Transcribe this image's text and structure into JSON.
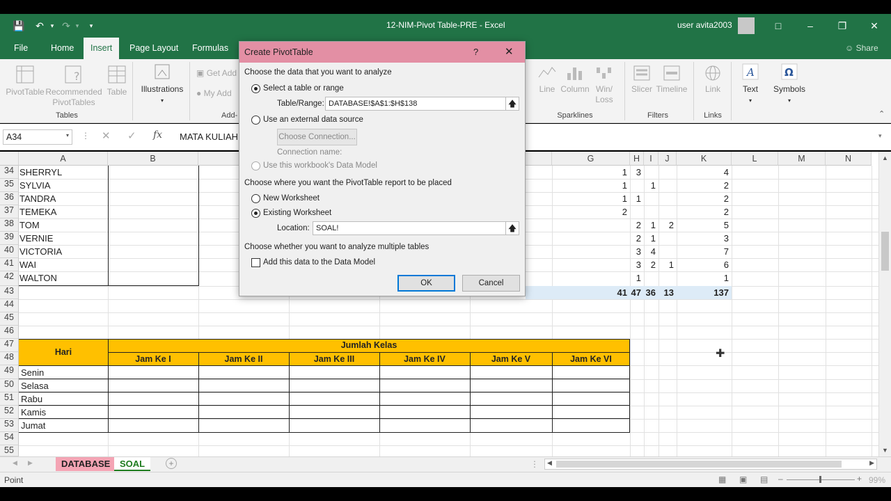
{
  "window": {
    "title": "12-NIM-Pivot Table-PRE  -  Excel",
    "user": "user avita2003",
    "share": "Share"
  },
  "tabs": [
    "File",
    "Home",
    "Insert",
    "Page Layout",
    "Formulas"
  ],
  "active_tab": "Insert",
  "ribbon": {
    "pivottable": "PivotTable",
    "recommended": "Recommended",
    "recommended2": "PivotTables",
    "table": "Table",
    "tables_group": "Tables",
    "illustrations": "Illustrations",
    "get_addins": "Get Add",
    "my_addins": "My Add",
    "addins_group": "Add-",
    "line": "Line",
    "column": "Column",
    "winloss": "Win/",
    "winloss2": "Loss",
    "sparklines_group": "Sparklines",
    "slicer": "Slicer",
    "timeline": "Timeline",
    "filters_group": "Filters",
    "link": "Link",
    "links_group": "Links",
    "text": "Text",
    "symbols": "Symbols"
  },
  "formula_bar": {
    "name_box": "A34",
    "formula": "MATA KULIAH"
  },
  "columns": [
    "A",
    "B",
    "G",
    "H",
    "I",
    "J",
    "K",
    "L",
    "M",
    "N"
  ],
  "rows_top": [
    {
      "num": "34",
      "name": "SHERRYL",
      "h": "1",
      "i": "3",
      "j": "",
      "k": "",
      "l": "4"
    },
    {
      "num": "35",
      "name": "SYLVIA",
      "h": "1",
      "i": "",
      "j": "1",
      "k": "",
      "l": "2"
    },
    {
      "num": "36",
      "name": "TANDRA",
      "h": "1",
      "i": "1",
      "j": "",
      "k": "",
      "l": "2"
    },
    {
      "num": "37",
      "name": "TEMEKA",
      "h": "2",
      "i": "",
      "j": "",
      "k": "",
      "l": "2"
    },
    {
      "num": "38",
      "name": "TOM",
      "h": "",
      "i": "2",
      "j": "1",
      "k": "2",
      "l": "5"
    },
    {
      "num": "39",
      "name": "VERNIE",
      "h": "",
      "i": "2",
      "j": "1",
      "k": "",
      "l": "3"
    },
    {
      "num": "40",
      "name": "VICTORIA",
      "h": "",
      "i": "3",
      "j": "4",
      "k": "",
      "l": "7"
    },
    {
      "num": "41",
      "name": "WAI",
      "h": "",
      "i": "3",
      "j": "2",
      "k": "1",
      "l": "6"
    },
    {
      "num": "42",
      "name": "WALTON",
      "h": "",
      "i": "1",
      "j": "",
      "k": "",
      "l": "1"
    }
  ],
  "total_row": {
    "num": "43",
    "h": "41",
    "i": "47",
    "j": "36",
    "k": "13",
    "l": "137"
  },
  "empty_rows": [
    "44",
    "45",
    "46"
  ],
  "schedule": {
    "hari": "Hari",
    "jumlah_kelas": "Jumlah Kelas",
    "jam": [
      "Jam Ke I",
      "Jam Ke II",
      "Jam Ke III",
      "Jam Ke IV",
      "Jam Ke V",
      "Jam Ke VI"
    ],
    "row47": "47",
    "row48": "48",
    "days": [
      {
        "num": "49",
        "day": "Senin"
      },
      {
        "num": "50",
        "day": "Selasa"
      },
      {
        "num": "51",
        "day": "Rabu"
      },
      {
        "num": "52",
        "day": "Kamis"
      },
      {
        "num": "53",
        "day": "Jumat"
      }
    ],
    "after_rows": [
      "54",
      "55"
    ]
  },
  "sheets": [
    "DATABASE",
    "SOAL"
  ],
  "status": {
    "mode": "Point",
    "zoom": "99%"
  },
  "dialog": {
    "title": "Create PivotTable",
    "help": "?",
    "section1": "Choose the data that you want to analyze",
    "opt_table": "Select a table or range",
    "table_range_label": "Table/Range:",
    "table_range_value": "DATABASE!$A$1:$H$138",
    "opt_external": "Use an external data source",
    "choose_connection": "Choose Connection...",
    "connection_name": "Connection name:",
    "opt_datamodel": "Use this workbook's Data Model",
    "section2": "Choose where you want the PivotTable report to be placed",
    "opt_new": "New Worksheet",
    "opt_existing": "Existing Worksheet",
    "location_label": "Location:",
    "location_value": "SOAL!",
    "section3": "Choose whether you want to analyze multiple tables",
    "add_datamodel": "Add this data to the Data Model",
    "ok": "OK",
    "cancel": "Cancel"
  },
  "colors": {
    "excel_green": "#217346",
    "header_yellow": "#ffc000",
    "dialog_title": "#e38fa4",
    "database_tab": "#f4a4b4",
    "soal_tab_text": "#1e7b1e"
  }
}
